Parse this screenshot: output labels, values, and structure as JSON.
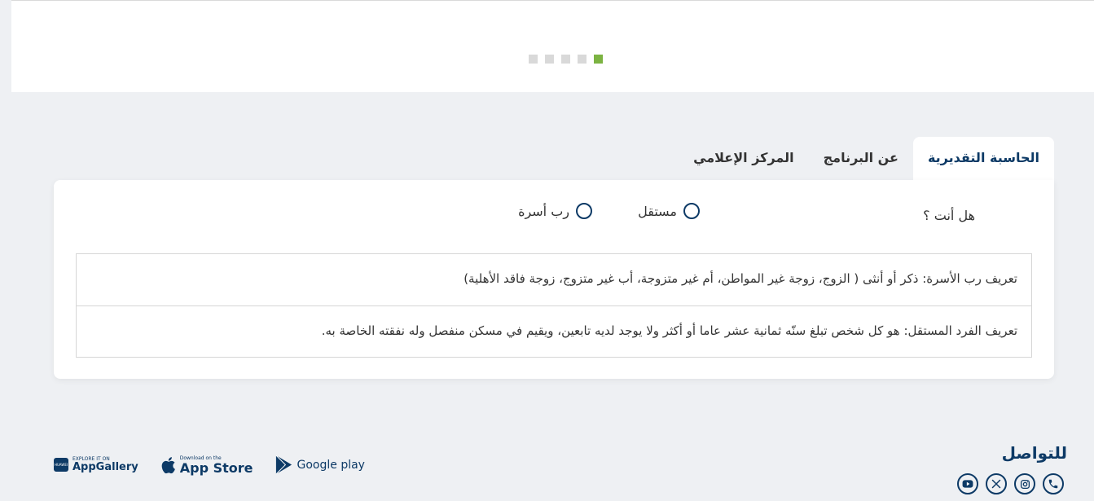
{
  "slider": {
    "dots": 5,
    "active_index": 4
  },
  "tabs": [
    {
      "label": "الحاسبة التقديرية",
      "active": true
    },
    {
      "label": "عن البرنامج",
      "active": false
    },
    {
      "label": "المركز الإعلامي",
      "active": false
    }
  ],
  "calculator": {
    "question": "هل أنت ؟",
    "options": [
      "مستقل",
      "رب أسرة"
    ],
    "definitions": [
      "تعريف رب الأسرة: ذكر أو أنثى ( الزوج، زوجة غير المواطن، أم غير متزوجة، أب غير متزوج، زوجة فاقد الأهلية)",
      "تعريف الفرد المستقل: هو كل شخص تبلغ سنّه ثمانية عشر عاما أو أكثر ولا يوجد لديه تابعين، ويقيم في مسكن منفصل وله نفقته الخاصة به."
    ]
  },
  "footer": {
    "contact_title": "للتواصل",
    "socials": [
      "phone-icon",
      "instagram-icon",
      "x-icon",
      "youtube-icon"
    ],
    "stores": {
      "google": {
        "label": "Google play"
      },
      "apple": {
        "small": "Download on the",
        "big": "App Store"
      },
      "huawei": {
        "small": "EXPLORE IT ON",
        "big": "AppGallery",
        "badge": "HUAWEI"
      }
    }
  },
  "colors": {
    "brand": "#0d3a66",
    "accent": "#7cb342",
    "background": "#eef0f3"
  }
}
